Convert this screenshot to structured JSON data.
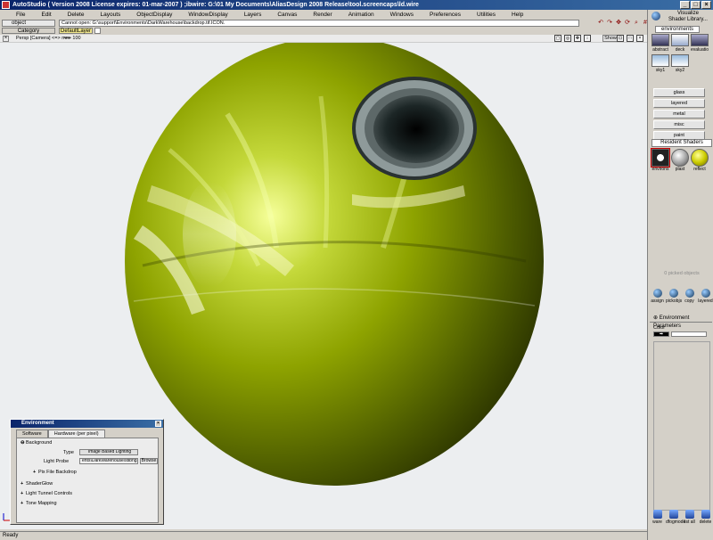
{
  "window": {
    "title": "AutoStudio ( Version 2008 License expires: 01-mar-2007 ) ;ibwire: G:\\01 My Documents\\AliasDesign 2008 Release\\tool.screencaps\\ld.wire",
    "min_label": "_",
    "max_label": "□",
    "close_label": "×"
  },
  "menubar": [
    "File",
    "Edit",
    "Delete",
    "Layouts",
    "ObjectDisplay",
    "WindowDisplay",
    "Layers",
    "Canvas",
    "Render",
    "Animation",
    "Windows",
    "Preferences",
    "Utilities",
    "Help"
  ],
  "toolbar": {
    "picker_label": "object",
    "status_message": "Cannot open: G:\\support\\Environments\\DarkWarehouse\\backdrop.tif.ICON.",
    "category_label": "Category",
    "layer_name": "DefaultLayer"
  },
  "viewport": {
    "title": "Persp [Camera] <=> mm",
    "zoom": "100",
    "show_label": "Show"
  },
  "right_panel": {
    "visualize_label": "Visualize",
    "shader_library_label": "Shader Library...",
    "environments_tab": "environments",
    "env_thumbs_row1": [
      "abstract",
      "deck",
      "evaluatio"
    ],
    "env_thumbs_row2": [
      "sky1",
      "sky2"
    ],
    "categories": [
      "glass",
      "layered",
      "metal",
      "misc",
      "paint"
    ],
    "resident_title": "Resident Shaders",
    "resident_shaders": [
      "environs",
      "plast",
      "reflect"
    ],
    "picked_objects": "0 picked objects",
    "actions": [
      "assign",
      "pickobjs",
      "copy",
      "layered"
    ],
    "env_params_title": "Environment Parameters",
    "color_label": "Color",
    "bottom_actions": [
      "ware",
      "dfogmode",
      "list all",
      "delete"
    ]
  },
  "env_window": {
    "title": "Environment",
    "close_label": "×",
    "tabs": [
      "Software",
      "Hardware (per pixel)"
    ],
    "background_label": "Background",
    "type_label": "Type",
    "type_value": "Image Based Lighting",
    "light_probe_label": "Light Probe",
    "light_probe_value": "ents\\DarkWarehouse\\stibng.hdr",
    "browse_label": "Browse",
    "sections": [
      "Pix File Backdrop",
      "ShaderGlow",
      "Light Tunnel Controls",
      "Tone Mapping"
    ]
  },
  "status": {
    "text": "Ready"
  },
  "colors": {
    "sphere": "#8ea300",
    "viewport_bg": "#eceef0",
    "titlebar": "#0a246a"
  }
}
